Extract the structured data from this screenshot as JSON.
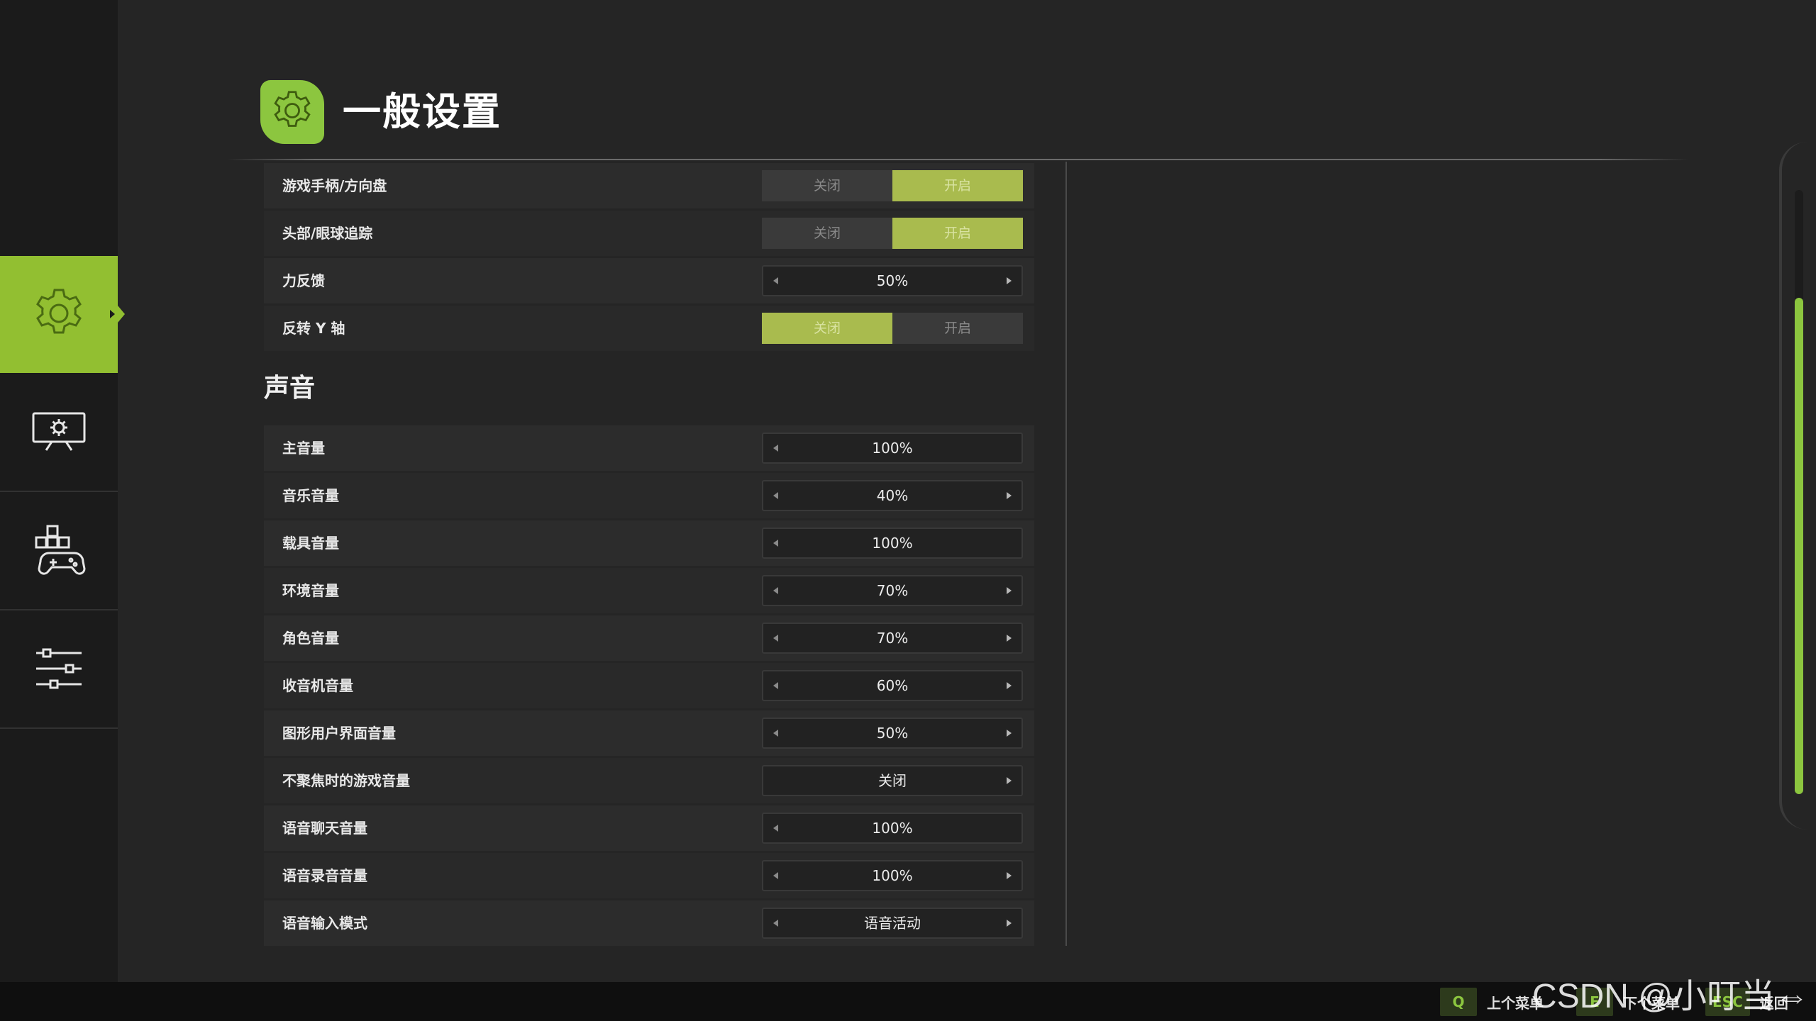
{
  "header": {
    "title": "一般设置"
  },
  "sidebar": {
    "items": [
      {
        "name": "general-settings",
        "icon": "gear-icon",
        "active": true
      },
      {
        "name": "display-settings",
        "icon": "monitor-gear-icon",
        "active": false
      },
      {
        "name": "controls-settings",
        "icon": "gamepad-keys-icon",
        "active": false
      },
      {
        "name": "advanced-settings",
        "icon": "sliders-icon",
        "active": false
      }
    ]
  },
  "controls_rows": [
    {
      "label": "游戏手柄/方向盘",
      "type": "toggle",
      "off": "关闭",
      "on": "开启",
      "selected": "on"
    },
    {
      "label": "头部/眼球追踪",
      "type": "toggle",
      "off": "关闭",
      "on": "开启",
      "selected": "on"
    },
    {
      "label": "力反馈",
      "type": "stepper",
      "value": "50%"
    },
    {
      "label": "反转 Y 轴",
      "type": "toggle",
      "off": "关闭",
      "on": "开启",
      "selected": "off"
    }
  ],
  "sound": {
    "section_title": "声音",
    "rows": [
      {
        "label": "主音量",
        "value": "100%"
      },
      {
        "label": "音乐音量",
        "value": "40%"
      },
      {
        "label": "载具音量",
        "value": "100%"
      },
      {
        "label": "环境音量",
        "value": "70%"
      },
      {
        "label": "角色音量",
        "value": "70%"
      },
      {
        "label": "收音机音量",
        "value": "60%"
      },
      {
        "label": "图形用户界面音量",
        "value": "50%"
      },
      {
        "label": "不聚焦时的游戏音量",
        "value": "关闭"
      },
      {
        "label": "语音聊天音量",
        "value": "100%"
      },
      {
        "label": "语音录音音量",
        "value": "100%"
      },
      {
        "label": "语音输入模式",
        "value": "语音活动"
      }
    ]
  },
  "bottom_bar": {
    "prev_key": "Q",
    "prev_label": "上个菜单",
    "next_key": "E",
    "next_label": "下个菜单",
    "back_key": "ESC",
    "back_label": "返回"
  },
  "watermark": "CSDN @小叮当⇔",
  "colors": {
    "accent": "#8cc63f",
    "toggle_on": "#a9bb4e",
    "background": "#252525",
    "sidebar": "#1b1b1b"
  }
}
